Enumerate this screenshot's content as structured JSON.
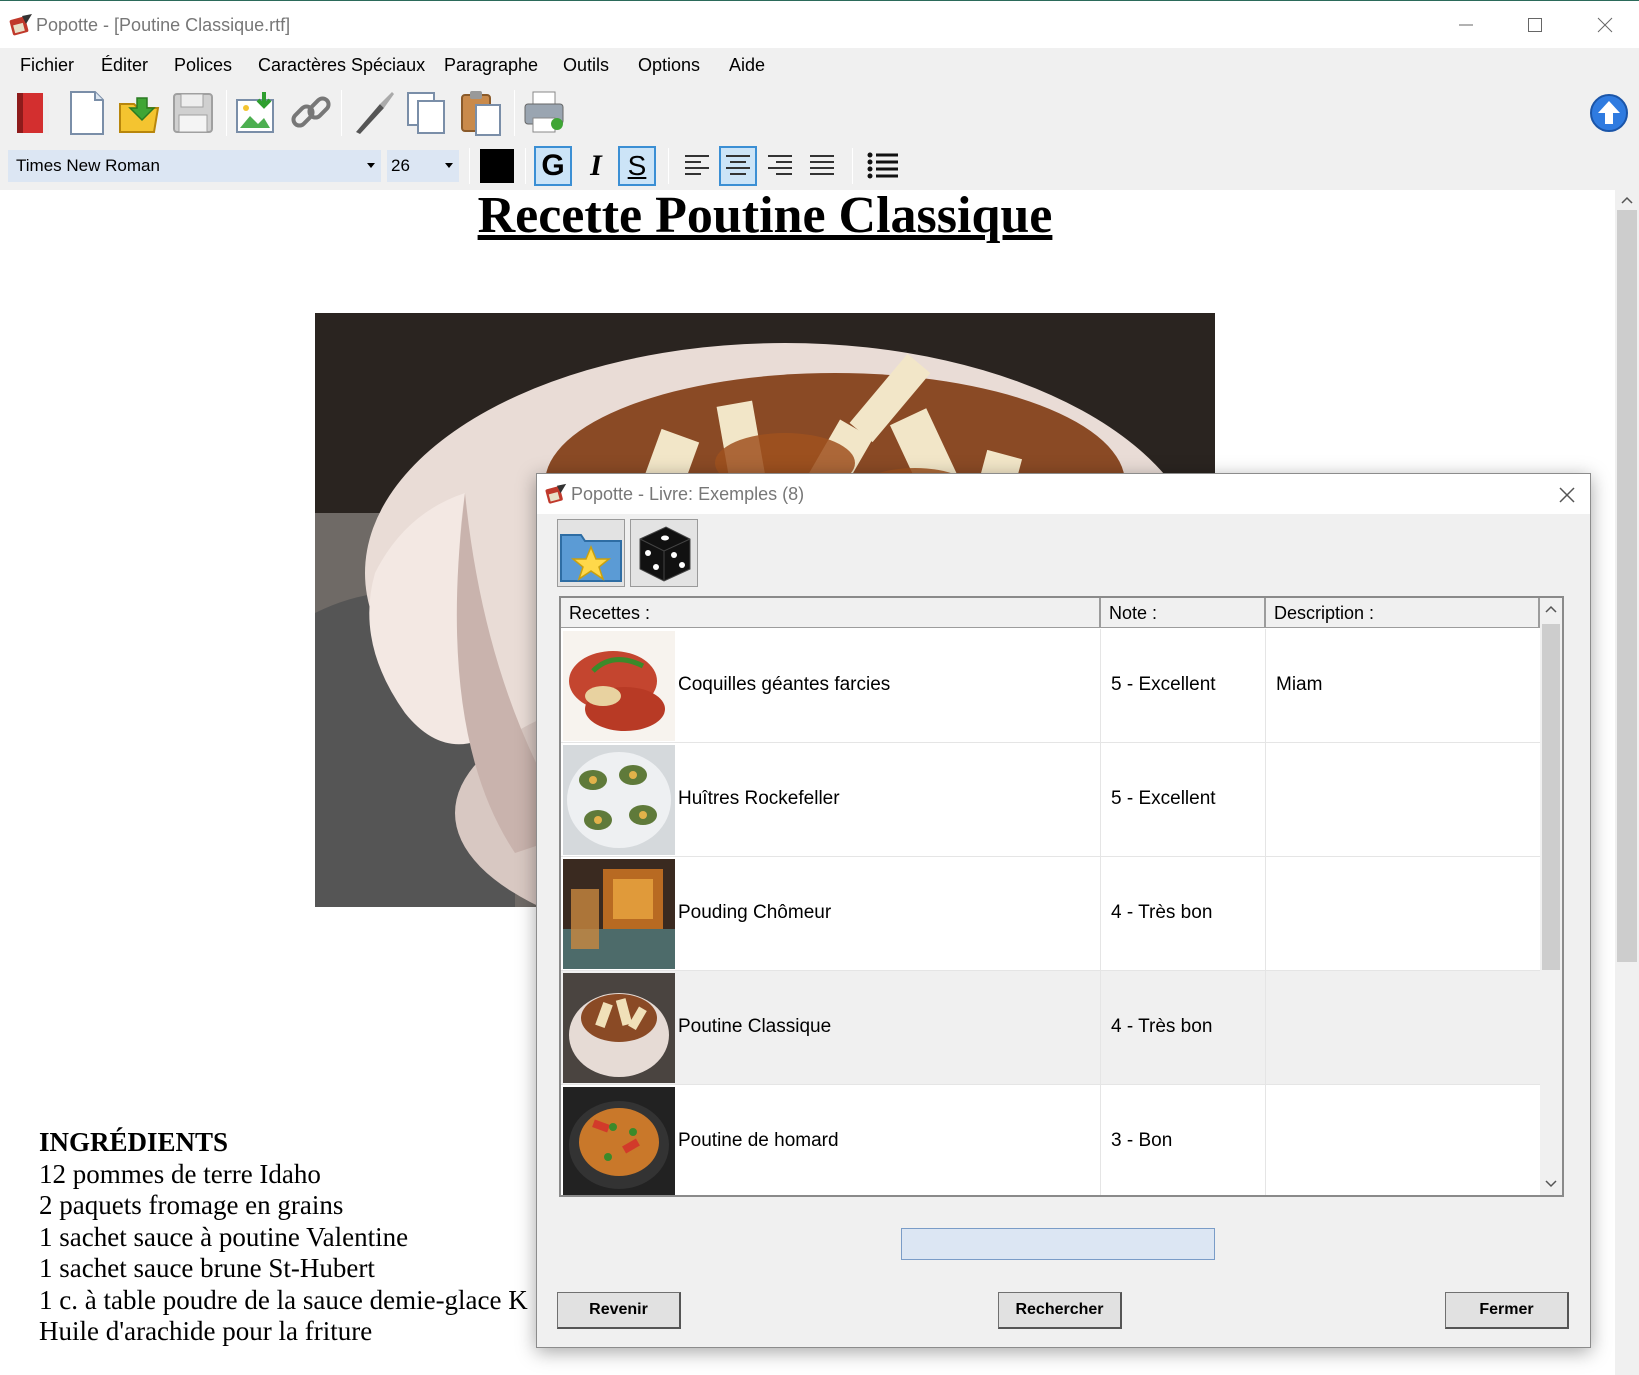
{
  "window": {
    "title": "Popotte - [Poutine Classique.rtf]"
  },
  "menu": [
    "Fichier",
    "Éditer",
    "Polices",
    "Caractères Spéciaux",
    "Paragraphe",
    "Outils",
    "Options",
    "Aide"
  ],
  "format": {
    "font": "Times New Roman",
    "size": "26",
    "bold_label": "G",
    "italic_label": "I",
    "underline_label": "S"
  },
  "document": {
    "title": "Recette Poutine Classique",
    "ingredients_heading": "INGRÉDIENTS",
    "ingredients": [
      "12 pommes de terre Idaho",
      "2 paquets fromage en grains",
      "1 sachet sauce à poutine Valentine",
      "1 sachet sauce brune St-Hubert",
      "1 c. à table poudre de la sauce demie-glace K",
      "Huile d'arachide pour la friture"
    ]
  },
  "dialog": {
    "title": "Popotte - Livre: Exemples (8)",
    "columns": {
      "recipes": "Recettes :",
      "note": "Note :",
      "description": "Description :"
    },
    "rows": [
      {
        "name": "Coquilles géantes farcies",
        "note": "5 - Excellent",
        "description": "Miam"
      },
      {
        "name": "Huîtres Rockefeller",
        "note": "5 - Excellent",
        "description": ""
      },
      {
        "name": "Pouding Chômeur",
        "note": "4 - Très bon",
        "description": ""
      },
      {
        "name": "Poutine Classique",
        "note": "4 - Très bon",
        "description": ""
      },
      {
        "name": "Poutine de homard",
        "note": "3 - Bon",
        "description": ""
      }
    ],
    "search_value": "",
    "buttons": {
      "back": "Revenir",
      "search": "Rechercher",
      "close": "Fermer"
    }
  },
  "colors": {
    "accent": "#3b8fd4",
    "input_bg": "#dce6f3",
    "chrome": "#f0f0f0"
  }
}
